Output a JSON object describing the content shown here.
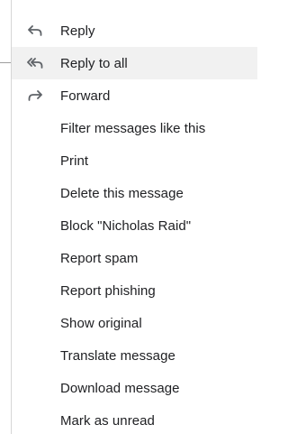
{
  "menu": {
    "items": [
      {
        "label": "Reply",
        "icon": "reply-icon"
      },
      {
        "label": "Reply to all",
        "icon": "reply-all-icon",
        "highlighted": true
      },
      {
        "label": "Forward",
        "icon": "forward-icon"
      },
      {
        "label": "Filter messages like this"
      },
      {
        "label": "Print"
      },
      {
        "label": "Delete this message"
      },
      {
        "label": "Block \"Nicholas Raid\""
      },
      {
        "label": "Report spam"
      },
      {
        "label": "Report phishing"
      },
      {
        "label": "Show original"
      },
      {
        "label": "Translate message"
      },
      {
        "label": "Download message"
      },
      {
        "label": "Mark as unread"
      }
    ]
  },
  "colors": {
    "text": "#202124",
    "icon": "#5f6368",
    "hover": "#f1f1f1",
    "divider": "#d6d6d6"
  }
}
